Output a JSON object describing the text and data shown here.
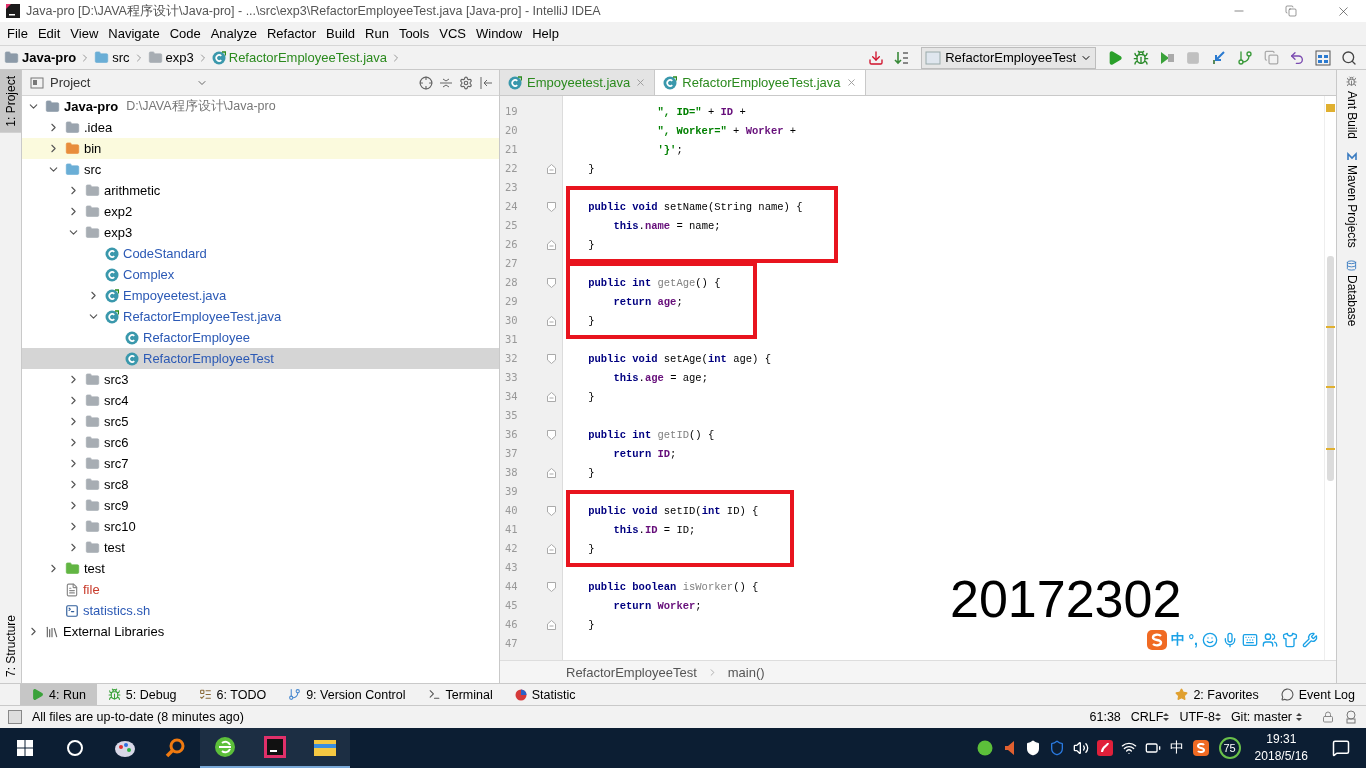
{
  "window": {
    "title": "Java-pro [D:\\JAVA程序设计\\Java-pro] - ...\\src\\exp3\\RefactorEmployeeTest.java [Java-pro] - IntelliJ IDEA"
  },
  "menu": [
    "File",
    "Edit",
    "View",
    "Navigate",
    "Code",
    "Analyze",
    "Refactor",
    "Build",
    "Run",
    "Tools",
    "VCS",
    "Window",
    "Help"
  ],
  "breadcrumbs": [
    {
      "label": "Java-pro",
      "kind": "module"
    },
    {
      "label": "src",
      "kind": "source-folder"
    },
    {
      "label": "exp3",
      "kind": "package"
    },
    {
      "label": "RefactorEmployeeTest.java",
      "kind": "class-file"
    }
  ],
  "run_config": "RefactorEmployeeTest",
  "left_tool_tabs": [
    {
      "label": "1: Project",
      "selected": true
    },
    {
      "label": "7: Structure",
      "selected": false
    }
  ],
  "project_panel": {
    "title": "Project"
  },
  "tree": [
    {
      "label": "Java-pro",
      "path": "D:\\JAVA程序设计\\Java-pro",
      "kind": "module",
      "expanded": true,
      "selected": false,
      "children": [
        {
          "label": ".idea",
          "kind": "folder",
          "expanded": false,
          "selected": false
        },
        {
          "label": "bin",
          "kind": "excluded-folder",
          "expanded": false,
          "selected": false
        },
        {
          "label": "src",
          "kind": "source-folder",
          "expanded": true,
          "selected": false,
          "children": [
            {
              "label": "arithmetic",
              "kind": "package",
              "expanded": false,
              "selected": false
            },
            {
              "label": "exp2",
              "kind": "package",
              "expanded": false,
              "selected": false
            },
            {
              "label": "exp3",
              "kind": "package",
              "expanded": true,
              "selected": false,
              "children": [
                {
                  "label": "CodeStandard",
                  "kind": "class",
                  "color": "#2b59b5",
                  "selected": false
                },
                {
                  "label": "Complex",
                  "kind": "class",
                  "color": "#2b59b5",
                  "selected": false
                },
                {
                  "label": "Empoyeetest.java",
                  "kind": "class-file",
                  "color": "#2b59b5",
                  "expanded": false,
                  "selected": false
                },
                {
                  "label": "RefactorEmployeeTest.java",
                  "kind": "class-file",
                  "color": "#2b59b5",
                  "expanded": true,
                  "selected": false,
                  "children": [
                    {
                      "label": "RefactorEmployee",
                      "kind": "class",
                      "color": "#2b59b5",
                      "selected": false
                    },
                    {
                      "label": "RefactorEmployeeTest",
                      "kind": "class",
                      "color": "#2b59b5",
                      "selected": true
                    }
                  ]
                }
              ]
            },
            {
              "label": "src3",
              "kind": "package",
              "expanded": false,
              "selected": false
            },
            {
              "label": "src4",
              "kind": "package",
              "expanded": false,
              "selected": false
            },
            {
              "label": "src5",
              "kind": "package",
              "expanded": false,
              "selected": false
            },
            {
              "label": "src6",
              "kind": "package",
              "expanded": false,
              "selected": false
            },
            {
              "label": "src7",
              "kind": "package",
              "expanded": false,
              "selected": false
            },
            {
              "label": "src8",
              "kind": "package",
              "expanded": false,
              "selected": false
            },
            {
              "label": "src9",
              "kind": "package",
              "expanded": false,
              "selected": false
            },
            {
              "label": "src10",
              "kind": "package",
              "expanded": false,
              "selected": false
            },
            {
              "label": "test",
              "kind": "package",
              "expanded": false,
              "selected": false
            }
          ]
        },
        {
          "label": "test",
          "kind": "test-folder",
          "expanded": false,
          "selected": false
        },
        {
          "label": "file",
          "kind": "file",
          "color": "#c83a2a",
          "selected": false
        },
        {
          "label": "statistics.sh",
          "kind": "shell",
          "color": "#2b59b5",
          "selected": false
        }
      ]
    },
    {
      "label": "External Libraries",
      "kind": "library",
      "expanded": false,
      "selected": false
    }
  ],
  "editor_tabs": [
    {
      "label": "Empoyeetest.java",
      "selected": false
    },
    {
      "label": "RefactorEmployeeTest.java",
      "selected": true
    }
  ],
  "code_lines": [
    {
      "number": "19",
      "kind": "continuation",
      "tokens": [
        {
          "kind": "str",
          "text": "\", ID=\""
        },
        {
          "kind": "plain",
          "text": " + "
        },
        {
          "kind": "field",
          "text": "ID"
        },
        {
          "kind": "plain",
          "text": " +"
        }
      ]
    },
    {
      "number": "20",
      "kind": "continuation",
      "tokens": [
        {
          "kind": "str",
          "text": "\", Worker=\""
        },
        {
          "kind": "plain",
          "text": " + "
        },
        {
          "kind": "field",
          "text": "Worker"
        },
        {
          "kind": "plain",
          "text": " +"
        }
      ]
    },
    {
      "number": "21",
      "kind": "continuation",
      "tokens": [
        {
          "kind": "str",
          "text": "'}'"
        },
        {
          "kind": "plain",
          "text": ";"
        }
      ]
    },
    {
      "number": "22",
      "kind": "block-end",
      "tokens": [
        {
          "kind": "plain",
          "text": "}"
        }
      ]
    },
    {
      "number": "23",
      "kind": "blank"
    },
    {
      "number": "24",
      "kind": "block-start",
      "boxed": true,
      "tokens": [
        {
          "kind": "kw",
          "text": "public void "
        },
        {
          "kind": "plain",
          "text": "setName(String name) {"
        }
      ]
    },
    {
      "number": "25",
      "kind": "code",
      "boxed": true,
      "tokens": [
        {
          "kind": "kw",
          "text": "this"
        },
        {
          "kind": "plain",
          "text": "."
        },
        {
          "kind": "field",
          "text": "name"
        },
        {
          "kind": "plain",
          "text": " = name;"
        }
      ]
    },
    {
      "number": "26",
      "kind": "block-end",
      "boxed": true,
      "tokens": [
        {
          "kind": "plain",
          "text": "}"
        }
      ]
    },
    {
      "number": "27",
      "kind": "blank"
    },
    {
      "number": "28",
      "kind": "block-start",
      "boxed": true,
      "tokens": [
        {
          "kind": "kw",
          "text": "public int "
        },
        {
          "kind": "unused",
          "text": "getAge"
        },
        {
          "kind": "plain",
          "text": "() {"
        }
      ]
    },
    {
      "number": "29",
      "kind": "code",
      "boxed": true,
      "tokens": [
        {
          "kind": "kw",
          "text": "return "
        },
        {
          "kind": "field",
          "text": "age"
        },
        {
          "kind": "plain",
          "text": ";"
        }
      ]
    },
    {
      "number": "30",
      "kind": "block-end",
      "boxed": true,
      "tokens": [
        {
          "kind": "plain",
          "text": "}"
        }
      ]
    },
    {
      "number": "31",
      "kind": "blank"
    },
    {
      "number": "32",
      "kind": "block-start",
      "tokens": [
        {
          "kind": "kw",
          "text": "public void "
        },
        {
          "kind": "plain",
          "text": "setAge("
        },
        {
          "kind": "kw",
          "text": "int "
        },
        {
          "kind": "plain",
          "text": "age) {"
        }
      ]
    },
    {
      "number": "33",
      "kind": "code",
      "tokens": [
        {
          "kind": "kw",
          "text": "this"
        },
        {
          "kind": "plain",
          "text": "."
        },
        {
          "kind": "field",
          "text": "age"
        },
        {
          "kind": "plain",
          "text": " = age;"
        }
      ]
    },
    {
      "number": "34",
      "kind": "block-end",
      "tokens": [
        {
          "kind": "plain",
          "text": "}"
        }
      ]
    },
    {
      "number": "35",
      "kind": "blank"
    },
    {
      "number": "36",
      "kind": "block-start",
      "tokens": [
        {
          "kind": "kw",
          "text": "public int "
        },
        {
          "kind": "unused",
          "text": "getID"
        },
        {
          "kind": "plain",
          "text": "() {"
        }
      ]
    },
    {
      "number": "37",
      "kind": "code",
      "tokens": [
        {
          "kind": "kw",
          "text": "return "
        },
        {
          "kind": "field",
          "text": "ID"
        },
        {
          "kind": "plain",
          "text": ";"
        }
      ]
    },
    {
      "number": "38",
      "kind": "block-end",
      "tokens": [
        {
          "kind": "plain",
          "text": "}"
        }
      ]
    },
    {
      "number": "39",
      "kind": "blank"
    },
    {
      "number": "40",
      "kind": "block-start",
      "boxed": true,
      "tokens": [
        {
          "kind": "kw",
          "text": "public void "
        },
        {
          "kind": "plain",
          "text": "setID("
        },
        {
          "kind": "kw",
          "text": "int "
        },
        {
          "kind": "plain",
          "text": "ID) {"
        }
      ]
    },
    {
      "number": "41",
      "kind": "code",
      "boxed": true,
      "tokens": [
        {
          "kind": "kw",
          "text": "this"
        },
        {
          "kind": "plain",
          "text": "."
        },
        {
          "kind": "field",
          "text": "ID"
        },
        {
          "kind": "plain",
          "text": " = ID;"
        }
      ]
    },
    {
      "number": "42",
      "kind": "block-end",
      "boxed": true,
      "tokens": [
        {
          "kind": "plain",
          "text": "}"
        }
      ]
    },
    {
      "number": "43",
      "kind": "blank"
    },
    {
      "number": "44",
      "kind": "block-start",
      "tokens": [
        {
          "kind": "kw",
          "text": "public boolean "
        },
        {
          "kind": "unused",
          "text": "isWorker"
        },
        {
          "kind": "plain",
          "text": "() {"
        }
      ]
    },
    {
      "number": "45",
      "kind": "code",
      "tokens": [
        {
          "kind": "kw",
          "text": "return "
        },
        {
          "kind": "field",
          "text": "Worker"
        },
        {
          "kind": "plain",
          "text": ";"
        }
      ]
    },
    {
      "number": "46",
      "kind": "block-end",
      "tokens": [
        {
          "kind": "plain",
          "text": "}"
        }
      ]
    },
    {
      "number": "47",
      "kind": "blank"
    }
  ],
  "editor_breadcrumbs": [
    "RefactorEmployeeTest",
    "main()"
  ],
  "overlay_text": "20172302",
  "ime_bar": {
    "mode": "中",
    "punct": "°,"
  },
  "right_tool_tabs": [
    {
      "label": "Ant Build",
      "kind": "ant"
    },
    {
      "label": "Maven Projects",
      "kind": "maven"
    },
    {
      "label": "Database",
      "kind": "database"
    }
  ],
  "bottom_tools": [
    {
      "label": "4: Run",
      "kind": "run",
      "selected": true
    },
    {
      "label": "5: Debug",
      "kind": "debug",
      "selected": false
    },
    {
      "label": "6: TODO",
      "kind": "todo",
      "selected": false
    },
    {
      "label": "9: Version Control",
      "kind": "vcs",
      "selected": false
    },
    {
      "label": "Terminal",
      "kind": "terminal",
      "selected": false
    },
    {
      "label": "Statistic",
      "kind": "statistic",
      "selected": false
    }
  ],
  "bottom_tools_right": [
    {
      "label": "2: Favorites",
      "kind": "favorites"
    },
    {
      "label": "Event Log",
      "kind": "event-log"
    }
  ],
  "status": {
    "message": "All files are up-to-date (8 minutes ago)",
    "position": "61:38",
    "line_separator": "CRLF",
    "encoding": "UTF-8",
    "vcs_branch": "Git: master"
  },
  "taskbar": {
    "ime": "中",
    "badge": "75",
    "time": "19:31",
    "date": "2018/5/16"
  }
}
